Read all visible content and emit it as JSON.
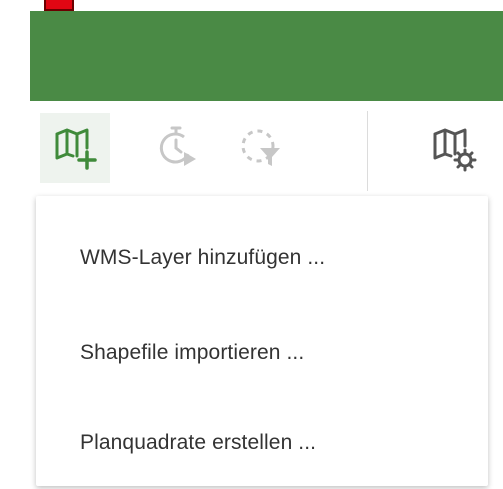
{
  "colors": {
    "header_green": "#4a8a45",
    "icon_active": "#3f8a3a",
    "icon_disabled": "#c7c7c7",
    "icon_dark": "#555555",
    "red_marker": "#e10613"
  },
  "toolbar": {
    "tools": [
      {
        "icon": "map-add-icon",
        "state": "active"
      },
      {
        "icon": "timer-play-icon",
        "state": "disabled"
      },
      {
        "icon": "dashed-circle-filter-icon",
        "state": "disabled"
      },
      {
        "icon": "map-settings-icon",
        "state": "enabled"
      }
    ]
  },
  "dropdown": {
    "items": [
      {
        "label": "WMS-Layer hinzufügen ..."
      },
      {
        "label": "Shapefile importieren ..."
      },
      {
        "label": "Planquadrate erstellen ..."
      }
    ]
  }
}
